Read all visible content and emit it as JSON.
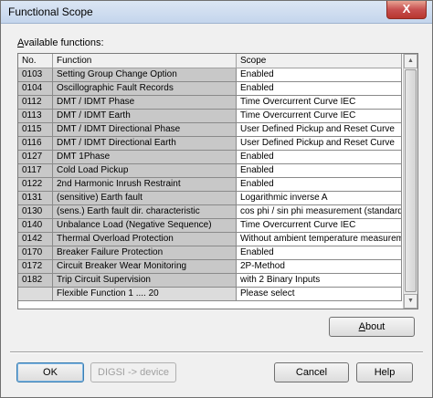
{
  "window": {
    "title": "Functional Scope",
    "close_glyph": "X"
  },
  "available_label": {
    "ul": "A",
    "rest": "vailable functions:"
  },
  "table": {
    "headers": [
      "No.",
      "Function",
      "Scope"
    ],
    "rows": [
      {
        "no": "0103",
        "function": "Setting Group Change Option",
        "scope": "Enabled"
      },
      {
        "no": "0104",
        "function": "Oscillographic Fault Records",
        "scope": "Enabled"
      },
      {
        "no": "0112",
        "function": "DMT / IDMT Phase",
        "scope": "Time Overcurrent Curve  IEC"
      },
      {
        "no": "0113",
        "function": "DMT / IDMT Earth",
        "scope": "Time Overcurrent Curve  IEC"
      },
      {
        "no": "0115",
        "function": "DMT / IDMT Directional Phase",
        "scope": "User Defined Pickup and Reset Curve"
      },
      {
        "no": "0116",
        "function": "DMT / IDMT Directional Earth",
        "scope": "User Defined Pickup and Reset Curve"
      },
      {
        "no": "0127",
        "function": "DMT 1Phase",
        "scope": "Enabled"
      },
      {
        "no": "0117",
        "function": "Cold Load Pickup",
        "scope": "Enabled"
      },
      {
        "no": "0122",
        "function": "2nd Harmonic Inrush Restraint",
        "scope": "Enabled"
      },
      {
        "no": "0131",
        "function": "(sensitive) Earth fault",
        "scope": "Logarithmic inverse A"
      },
      {
        "no": "0130",
        "function": "(sens.) Earth fault dir. characteristic",
        "scope": "cos phi / sin phi measurement (standard)"
      },
      {
        "no": "0140",
        "function": "Unbalance Load (Negative Sequence)",
        "scope": "Time Overcurrent Curve IEC"
      },
      {
        "no": "0142",
        "function": "Thermal Overload Protection",
        "scope": "Without ambient temperature measurement"
      },
      {
        "no": "0170",
        "function": "Breaker Failure Protection",
        "scope": "Enabled"
      },
      {
        "no": "0172",
        "function": "Circuit Breaker Wear Monitoring",
        "scope": "2P-Method"
      },
      {
        "no": "0182",
        "function": "Trip Circuit Supervision",
        "scope": "with 2 Binary Inputs"
      },
      {
        "no": "",
        "function": "Flexible Function 1 .... 20",
        "scope": "Please select"
      }
    ]
  },
  "buttons": {
    "about": {
      "ul": "A",
      "rest": "bout"
    },
    "ok": "OK",
    "digsi": "DIGSI -> device",
    "cancel": "Cancel",
    "help": "Help"
  },
  "icons": {
    "scroll_up": "up-arrow-icon",
    "scroll_down": "down-arrow-icon"
  }
}
